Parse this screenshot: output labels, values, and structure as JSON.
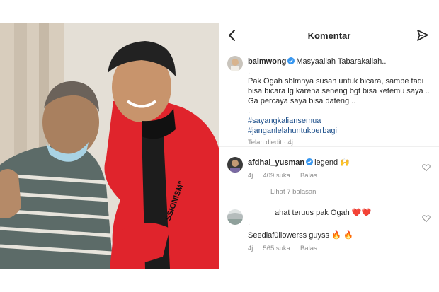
{
  "header": {
    "title": "Komentar"
  },
  "post": {
    "username": "baimwong",
    "line1": "Masyaallah Tabarakallah..",
    "dot1": ".",
    "line2": "Pak Ogah sblmnya susah untuk bicara, sampe tadi",
    "line3": "bisa bicara lg karena seneng bgt bisa ketemu saya ..",
    "line4": "Ga percaya saya bisa dateng ..",
    "dot2": ".",
    "hashtag1": "#sayangkaliansemua",
    "hashtag2": "#janganlelahuntukberbagi",
    "meta": "Telah diedit · 4j"
  },
  "comments": [
    {
      "username": "afdhal_yusman",
      "text": "legend",
      "emoji": "🙌",
      "time": "4j",
      "likes": "409 suka",
      "reply": "Balas",
      "replies_label": "Lihat 7 balasan"
    },
    {
      "text": "ahat teruus pak Ogah",
      "emoji": "❤️❤️",
      "dot": ".",
      "line2": "Seediaf0llowerss guyss",
      "emoji2": "🔥 🔥",
      "time": "4j",
      "likes": "565 suka",
      "reply": "Balas"
    }
  ],
  "colors": {
    "verified": "#3897f0",
    "hashtag": "#1d4f8a",
    "jacket": "#e0242c"
  },
  "icons": {
    "back": "chevron-left-icon",
    "share": "paper-plane-icon",
    "heart": "heart-outline-icon",
    "verified": "verified-badge-icon"
  }
}
